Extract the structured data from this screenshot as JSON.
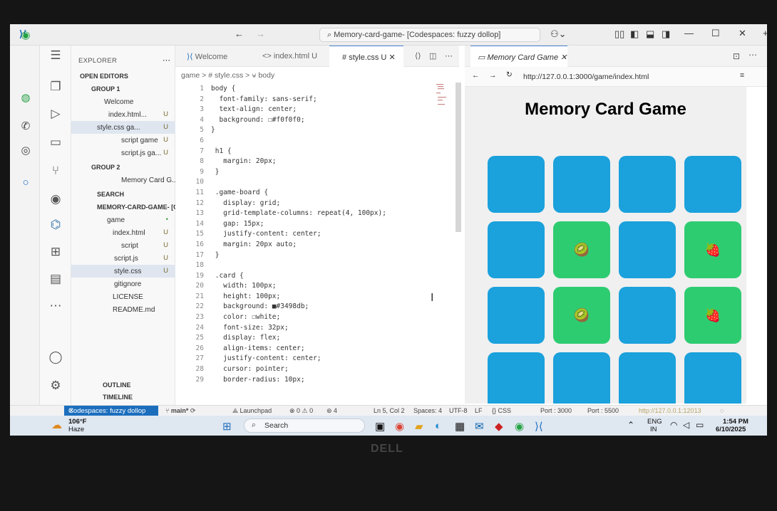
{
  "window": {
    "title": "Memory-card-game- [Codespaces: fuzzy dollop]"
  },
  "explorer": {
    "title": "EXPLORER",
    "open_editors": "OPEN EDITORS",
    "group1": "GROUP 1",
    "group1_items": [
      {
        "name": "Welcome",
        "badge": ""
      },
      {
        "name": "index.html...",
        "badge": "U"
      },
      {
        "name": "style.css ga...",
        "badge": "U"
      },
      {
        "name": "script game",
        "badge": "U"
      },
      {
        "name": "script.js ga...",
        "badge": "U"
      }
    ],
    "group2": "GROUP 2",
    "group2_items": [
      {
        "name": "Memory Card G..."
      }
    ],
    "search_section": "SEARCH",
    "project": "MEMORY-CARD-GAME- [C...",
    "tree": [
      {
        "name": "game",
        "badge": "•"
      },
      {
        "name": "index.html",
        "badge": "U"
      },
      {
        "name": "script",
        "badge": "U"
      },
      {
        "name": "script.js",
        "badge": "U"
      },
      {
        "name": "style.css",
        "badge": "U"
      },
      {
        "name": "gitignore",
        "badge": ""
      },
      {
        "name": "LICENSE",
        "badge": ""
      },
      {
        "name": "README.md",
        "badge": ""
      }
    ],
    "outline": "OUTLINE",
    "timeline": "TIMELINE"
  },
  "editor": {
    "tabs": [
      "Welcome",
      "index.html U",
      "style.css U"
    ],
    "breadcrumb": "game > # style.css > ⍱ body",
    "line_numbers": [
      "1",
      "2",
      "3",
      "4",
      "5",
      "6",
      "7",
      "8",
      "9",
      "10",
      "11",
      "12",
      "13",
      "14",
      "15",
      "16",
      "17",
      "18",
      "19",
      "20",
      "21",
      "22",
      "23",
      "24",
      "25",
      "26",
      "27",
      "28",
      "29"
    ],
    "lines": [
      "body {",
      "  font-family: sans-serif;",
      "  text-align: center;",
      "  background: ☐#f0f0f0;",
      "}",
      "",
      " h1 {",
      "   margin: 20px;",
      " }",
      "",
      " .game-board {",
      "   display: grid;",
      "   grid-template-columns: repeat(4, 100px);",
      "   gap: 15px;",
      "   justify-content: center;",
      "   margin: 20px auto;",
      " }",
      "",
      " .card {",
      "   width: 100px;",
      "   height: 100px;",
      "   background: ■#3498db;",
      "   color: ☐white;",
      "   font-size: 32px;",
      "   display: flex;",
      "   align-items: center;",
      "   justify-content: center;",
      "   cursor: pointer;",
      "   border-radius: 10px;"
    ]
  },
  "preview": {
    "tab": "Memory Card Game",
    "url": "http://127.0.0.1:3000/game/index.html",
    "page_title": "Memory Card Game",
    "cards": [
      [
        "",
        "",
        "",
        ""
      ],
      [
        "",
        "🥝",
        "",
        "🍓"
      ],
      [
        "",
        "🥝",
        "",
        "🍓"
      ],
      [
        "",
        "",
        "",
        ""
      ]
    ],
    "flipped_color": "#2ecc71",
    "hidden_color": "#1ba1dc"
  },
  "status": {
    "remote": "Codespaces: fuzzy dollop",
    "branch": "main*",
    "launchpad": "Launchpad",
    "problems": "⊗ 0 ⚠ 0",
    "ports": "4",
    "position": "Ln 5, Col 2",
    "spaces": "Spaces: 4",
    "encoding": "UTF-8",
    "eol": "LF",
    "lang": "{} CSS",
    "port1": "Port : 3000",
    "port2": "Port : 5500",
    "live": "http://127.0.0.1:12013"
  },
  "taskbar": {
    "weather_temp": "106°F",
    "weather_desc": "Haze",
    "search": "Search",
    "lang": "ENG",
    "region": "IN",
    "time": "1:54 PM",
    "date": "6/10/2025"
  }
}
